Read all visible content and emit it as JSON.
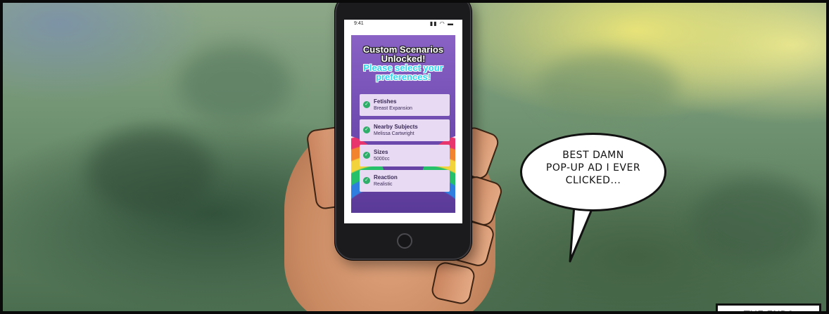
{
  "phone": {
    "status_time": "9:41",
    "status_icons": "signal-wifi-battery",
    "headline_line1": "Custom Scenarios",
    "headline_line2": "Unlocked!",
    "headline_line3": "Please select your",
    "headline_line4": "preferences!",
    "options": [
      {
        "title": "Fetishes",
        "value": "Breast Expansion"
      },
      {
        "title": "Nearby Subjects",
        "value": "Melissa Cartwright"
      },
      {
        "title": "Sizes",
        "value": "5000cc"
      },
      {
        "title": "Reaction",
        "value": "Realistic"
      }
    ]
  },
  "speech_bubble": {
    "line1": "BEST DAMN",
    "line2": "POP-UP AD I EVER",
    "line3": "CLICKED..."
  },
  "caption": {
    "text": "THE END?"
  },
  "colors": {
    "app_background": "#6e4aae",
    "headline_accent": "#2ed7f0",
    "card_background": "#e7daf2",
    "check": "#2fae6a"
  }
}
